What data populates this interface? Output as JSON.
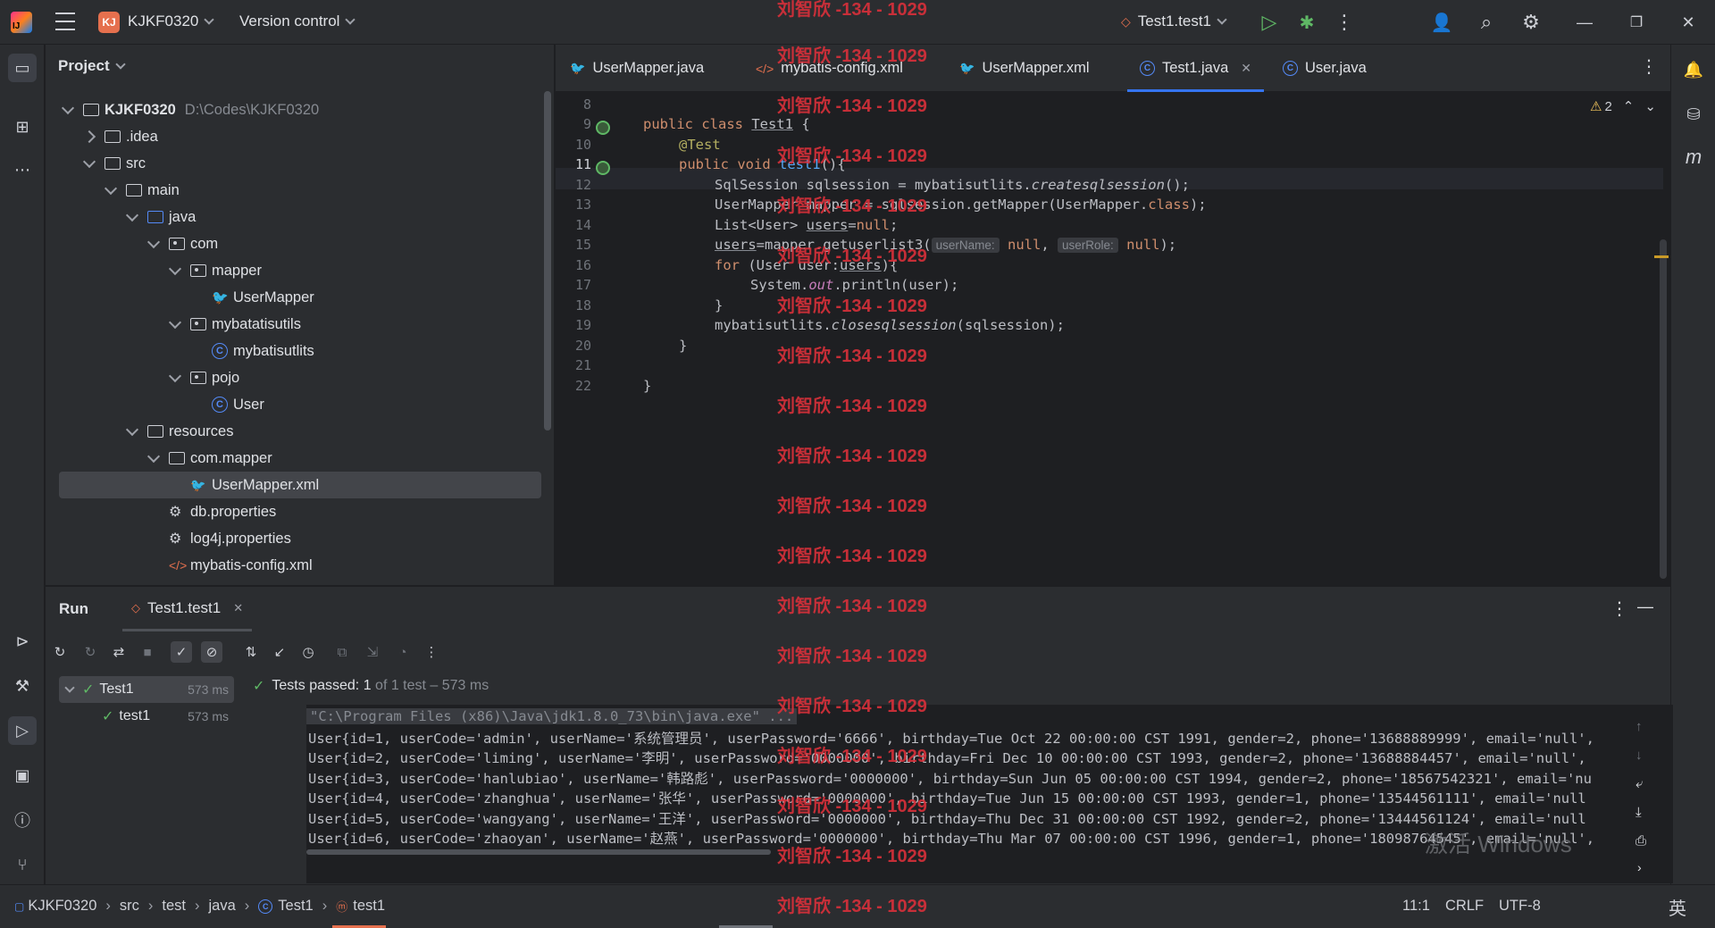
{
  "titlebar": {
    "project_badge": "KJ",
    "project_name": "KJKF0320",
    "vcs": "Version control",
    "run_config": "Test1.test1"
  },
  "project_panel": {
    "title": "Project",
    "tree": [
      {
        "label": "KJKF0320",
        "extra": "D:\\Codes\\KJKF0320"
      },
      {
        "label": ".idea"
      },
      {
        "label": "src"
      },
      {
        "label": "main"
      },
      {
        "label": "java"
      },
      {
        "label": "com"
      },
      {
        "label": "mapper"
      },
      {
        "label": "UserMapper"
      },
      {
        "label": "mybatatisutils"
      },
      {
        "label": "mybatisutlits"
      },
      {
        "label": "pojo"
      },
      {
        "label": "User"
      },
      {
        "label": "resources"
      },
      {
        "label": "com.mapper"
      },
      {
        "label": "UserMapper.xml"
      },
      {
        "label": "db.properties"
      },
      {
        "label": "log4j.properties"
      },
      {
        "label": "mybatis-config.xml"
      }
    ]
  },
  "editor": {
    "tabs": [
      {
        "label": "UserMapper.java"
      },
      {
        "label": "mybatis-config.xml"
      },
      {
        "label": "UserMapper.xml"
      },
      {
        "label": "Test1.java"
      },
      {
        "label": "User.java"
      }
    ],
    "warnings": "2",
    "line_numbers": [
      "8",
      "9",
      "10",
      "11",
      "12",
      "13",
      "14",
      "15",
      "16",
      "17",
      "18",
      "19",
      "20",
      "21",
      "22"
    ],
    "code": {
      "l9_kw": "public class ",
      "l9_name": "Test1",
      "l9_rest": " {",
      "l10": "@Test",
      "l11_kw": "public void ",
      "l11_fn": "test1",
      "l11_rest": "(){",
      "l12_a": "SqlSession sqlsession = mybatisutlits.",
      "l12_fn": "createsqlsession",
      "l12_b": "();",
      "l13_a": "UserMapper mapper = sqlsession.getMapper(UserMapper.",
      "l13_kw": "class",
      "l13_b": ");",
      "l14_a": "List<User> ",
      "l14_u": "users",
      "l14_b": "=",
      "l14_kw": "null",
      "l14_c": ";",
      "l15_u": "users",
      "l15_a": "=mapper.getuserlist3(",
      "l15_h1": "userName:",
      "l15_n1": "null",
      "l15_b": ", ",
      "l15_h2": "userRole:",
      "l15_n2": "null",
      "l15_c": ");",
      "l16_kw": "for",
      "l16_a": " (User user:",
      "l16_u": "users",
      "l16_b": "){",
      "l17_a": "System.",
      "l17_f": "out",
      "l17_b": ".println(user);",
      "l18": "}",
      "l19_a": "mybatisutlits.",
      "l19_fn": "closesqlsession",
      "l19_b": "(sqlsession);",
      "l20": "}",
      "l22": "}"
    }
  },
  "run_panel": {
    "title": "Run",
    "tab": "Test1.test1",
    "tests": [
      {
        "name": "Test1",
        "time": "573 ms"
      },
      {
        "name": "test1",
        "time": "573 ms"
      }
    ],
    "status_a": "Tests passed:",
    "status_b": "1",
    "status_c": "of 1 test – 573 ms",
    "console": [
      "\"C:\\Program Files (x86)\\Java\\jdk1.8.0_73\\bin\\java.exe\" ...",
      "User{id=1, userCode='admin', userName='系统管理员', userPassword='6666', birthday=Tue Oct 22 00:00:00 CST 1991, gender=2, phone='13688889999', email='null',",
      "User{id=2, userCode='liming', userName='李明', userPassword='0000000', birthday=Fri Dec 10 00:00:00 CST 1993, gender=2, phone='13688884457', email='null',",
      "User{id=3, userCode='hanlubiao', userName='韩路彪', userPassword='0000000', birthday=Sun Jun 05 00:00:00 CST 1994, gender=2, phone='18567542321', email='nu",
      "User{id=4, userCode='zhanghua', userName='张华', userPassword='0000000', birthday=Tue Jun 15 00:00:00 CST 1993, gender=1, phone='13544561111', email='null",
      "User{id=5, userCode='wangyang', userName='王洋', userPassword='0000000', birthday=Thu Dec 31 00:00:00 CST 1992, gender=2, phone='13444561124', email='null",
      "User{id=6, userCode='zhaoyan', userName='赵燕', userPassword='0000000', birthday=Thu Mar 07 00:00:00 CST 1996, gender=1, phone='18098764545', email='null',"
    ]
  },
  "statusbar": {
    "crumbs": [
      "KJKF0320",
      "src",
      "test",
      "java",
      "Test1",
      "test1"
    ],
    "position": "11:1",
    "line_sep": "CRLF",
    "encoding": "UTF-8",
    "ime": "英"
  },
  "watermark": "刘智欣 -134 - 1029",
  "windows_activation": "激活 Windows"
}
